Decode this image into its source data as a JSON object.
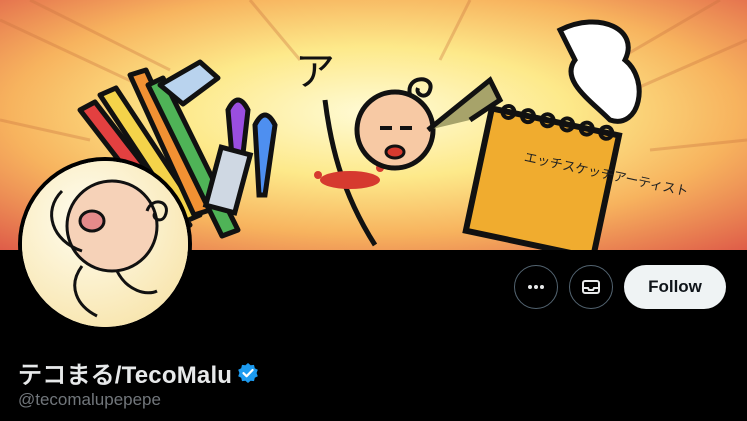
{
  "profile": {
    "display_name": "テコまる/TecoMalu",
    "handle": "@tecomalupepepe",
    "verified": true
  },
  "banner": {
    "art_text_a": "ア",
    "art_text_notepad": "エッチスケッチアーティスト"
  },
  "actions": {
    "more_icon": "ellipsis-icon",
    "message_icon": "envelope-icon",
    "follow_label": "Follow"
  },
  "colors": {
    "verified_blue": "#1d9bf0",
    "follow_bg": "#eff3f4",
    "background": "#000000",
    "muted_text": "#71767b"
  }
}
